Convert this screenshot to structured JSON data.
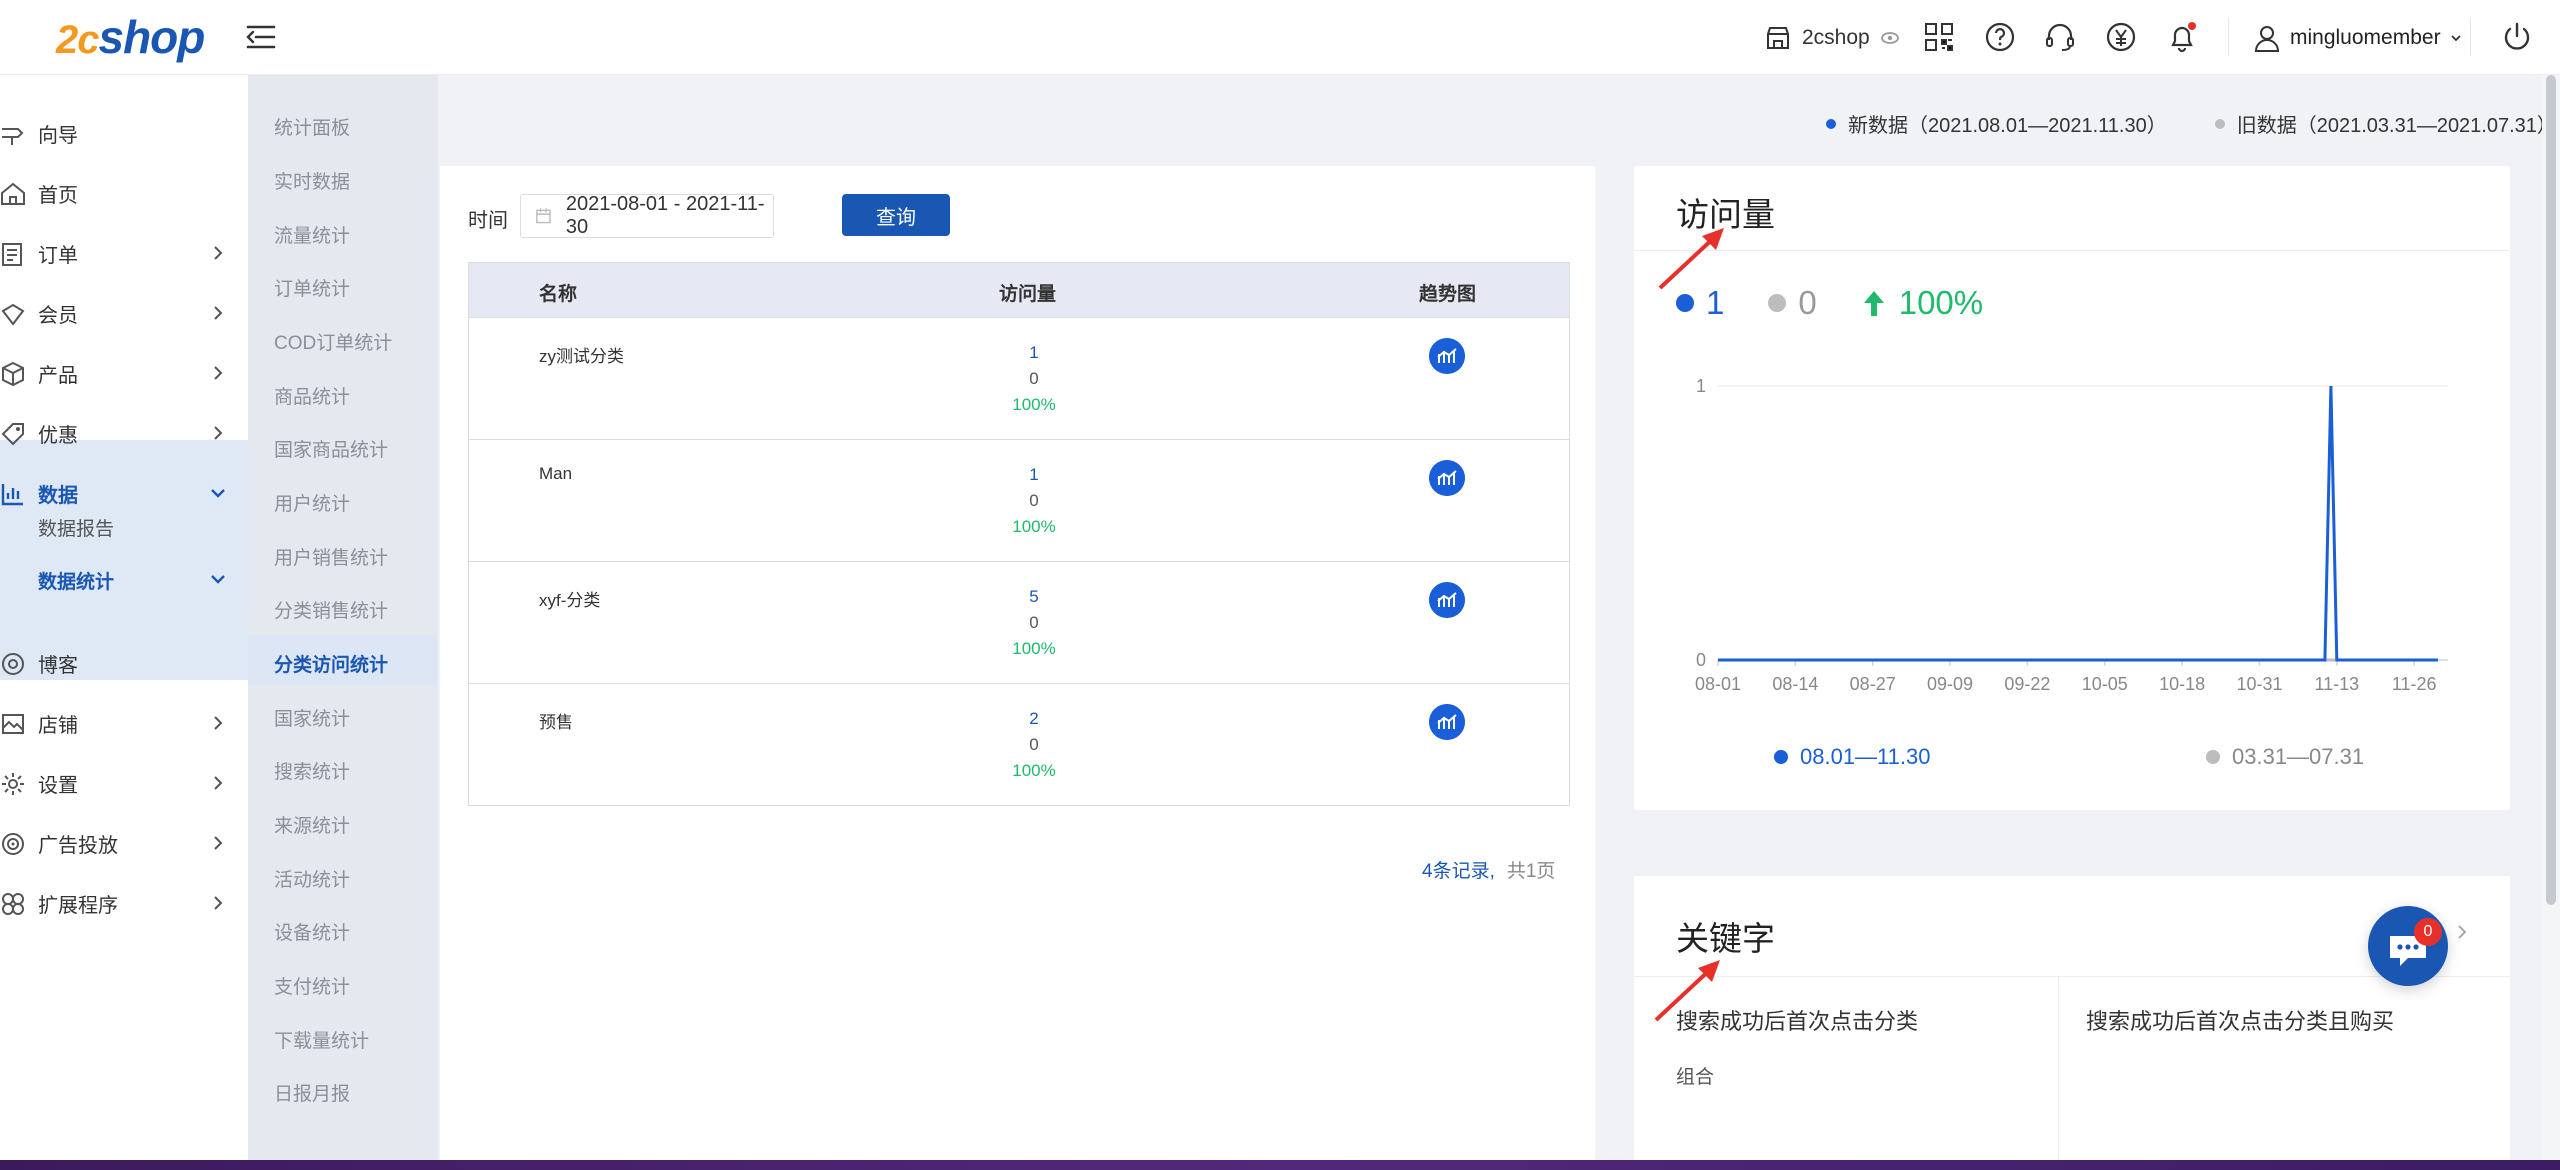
{
  "app": {
    "logo_num": "2c",
    "logo_text": "shop"
  },
  "topbar": {
    "store_name": "2cshop",
    "username": "mingluomember"
  },
  "sidebar": {
    "items": [
      {
        "label": "向导",
        "icon": "guide-icon"
      },
      {
        "label": "首页",
        "icon": "home-icon"
      },
      {
        "label": "订单",
        "icon": "order-icon"
      },
      {
        "label": "会员",
        "icon": "member-icon"
      },
      {
        "label": "产品",
        "icon": "product-icon"
      },
      {
        "label": "优惠",
        "icon": "discount-icon"
      },
      {
        "label": "数据",
        "icon": "data-chart-icon"
      },
      {
        "label": "博客",
        "icon": "blog-icon"
      },
      {
        "label": "店铺",
        "icon": "store-icon"
      },
      {
        "label": "设置",
        "icon": "settings-icon"
      },
      {
        "label": "广告投放",
        "icon": "ads-icon"
      },
      {
        "label": "扩展程序",
        "icon": "extensions-icon"
      }
    ],
    "data_subitems": [
      "数据报告",
      "数据统计"
    ]
  },
  "sidebar2": {
    "items": [
      "统计面板",
      "实时数据",
      "流量统计",
      "订单统计",
      "COD订单统计",
      "商品统计",
      "国家商品统计",
      "用户统计",
      "用户销售统计",
      "分类销售统计",
      "分类访问统计",
      "国家统计",
      "搜索统计",
      "来源统计",
      "活动统计",
      "设备统计",
      "支付统计",
      "下载量统计",
      "日报月报"
    ],
    "active": "分类访问统计"
  },
  "legend": {
    "new_label": "新数据（2021.08.01—2021.11.30）",
    "old_label": "旧数据（2021.03.31—2021.07.31）",
    "new_color": "#1a5fd8",
    "old_color": "#bdbdbd"
  },
  "filter": {
    "label": "时间",
    "date_range": "2021-08-01 - 2021-11-30",
    "query_button": "查询"
  },
  "table": {
    "headers": [
      "名称",
      "访问量",
      "趋势图"
    ],
    "rows": [
      {
        "name": "zy测试分类",
        "new": "1",
        "old": "0",
        "pct": "100%"
      },
      {
        "name": "Man",
        "new": "1",
        "old": "0",
        "pct": "100%"
      },
      {
        "name": "xyf-分类",
        "new": "5",
        "old": "0",
        "pct": "100%"
      },
      {
        "name": "预售",
        "new": "2",
        "old": "0",
        "pct": "100%"
      }
    ]
  },
  "pager": {
    "records": "4条记录,",
    "pages": "共1页"
  },
  "visit_card": {
    "title": "访问量",
    "new_value": "1",
    "old_value": "0",
    "change": "100%"
  },
  "chart_data": {
    "type": "line",
    "title": "访问量",
    "x_ticks": [
      "08-01",
      "08-14",
      "08-27",
      "09-09",
      "09-22",
      "10-05",
      "10-18",
      "10-31",
      "11-13",
      "11-26"
    ],
    "y_ticks": [
      "0",
      "1"
    ],
    "ylim": [
      0,
      1
    ],
    "series": [
      {
        "name": "08.01—11.30",
        "color": "#1a5fd8",
        "x": [
          "08-01",
          "11-11",
          "11-12",
          "11-13",
          "11-30"
        ],
        "values": [
          0,
          0,
          1,
          0,
          0
        ]
      },
      {
        "name": "03.31—07.31",
        "color": "#bdbdbd",
        "x": [
          "08-01",
          "11-30"
        ],
        "values": [
          0,
          0
        ]
      }
    ],
    "legend_position": "bottom"
  },
  "keyword_card": {
    "title": "关键字",
    "col1": "搜索成功后首次点击分类",
    "col2": "搜索成功后首次点击分类且购买",
    "col1_sub": "组合"
  },
  "chat": {
    "badge": "0"
  }
}
